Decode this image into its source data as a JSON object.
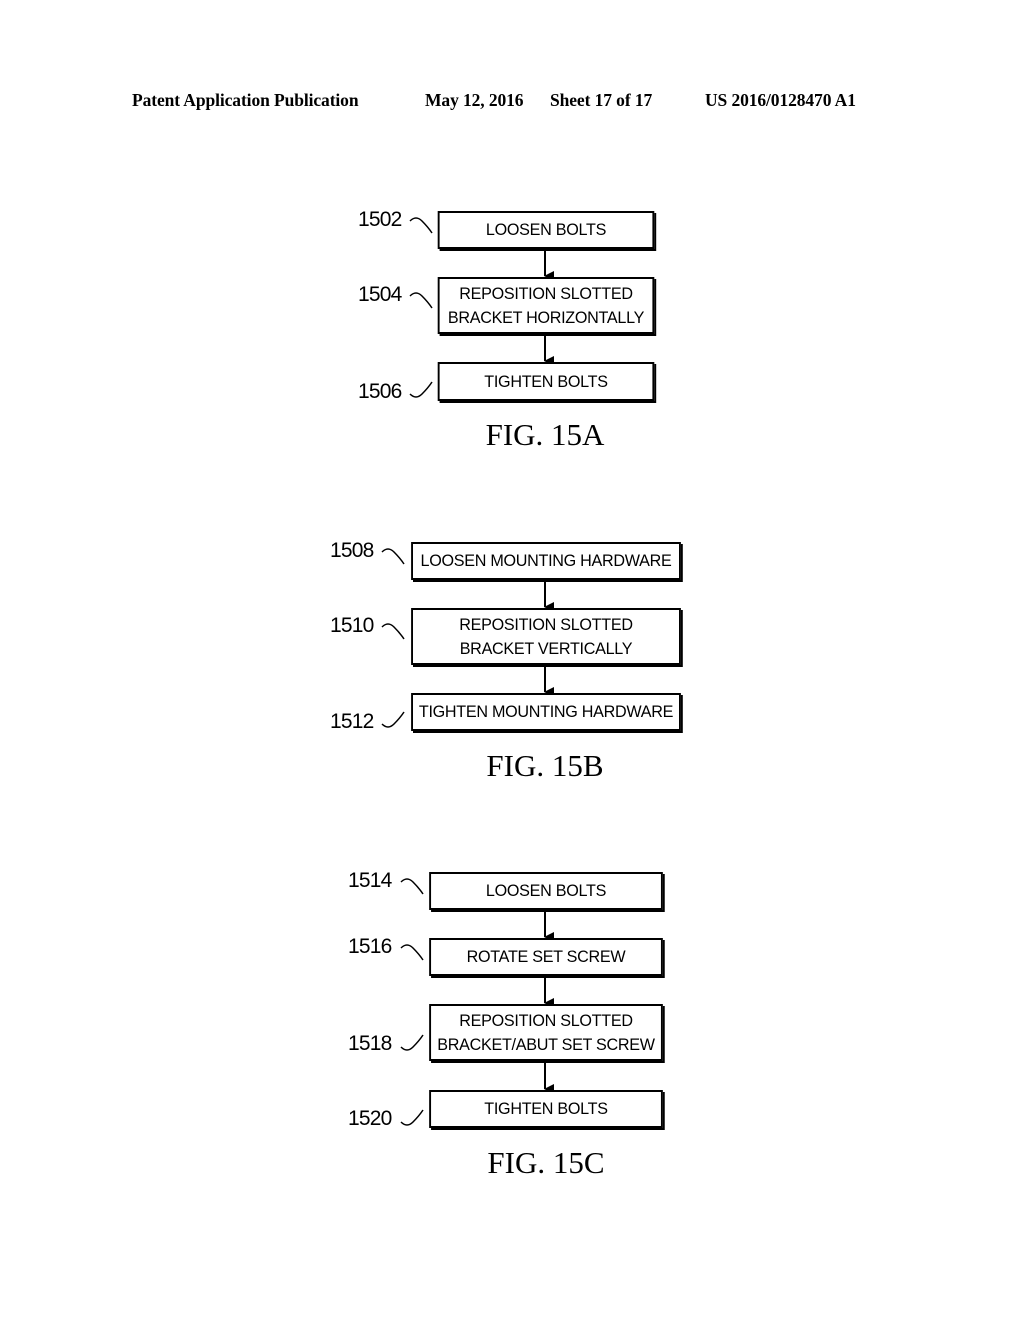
{
  "header": {
    "publication": "Patent Application Publication",
    "date": "May 12, 2016",
    "sheet": "Sheet 17 of 17",
    "number": "US 2016/0128470 A1"
  },
  "figures": [
    {
      "label": "FIG. 15A",
      "steps": [
        {
          "ref": "1502",
          "text": "LOOSEN BOLTS"
        },
        {
          "ref": "1504",
          "text": "REPOSITION SLOTTED\nBRACKET HORIZONTALLY"
        },
        {
          "ref": "1506",
          "text": "TIGHTEN BOLTS"
        }
      ]
    },
    {
      "label": "FIG. 15B",
      "steps": [
        {
          "ref": "1508",
          "text": "LOOSEN MOUNTING HARDWARE"
        },
        {
          "ref": "1510",
          "text": "REPOSITION SLOTTED\nBRACKET VERTICALLY"
        },
        {
          "ref": "1512",
          "text": "TIGHTEN MOUNTING HARDWARE"
        }
      ]
    },
    {
      "label": "FIG. 15C",
      "steps": [
        {
          "ref": "1514",
          "text": "LOOSEN BOLTS"
        },
        {
          "ref": "1516",
          "text": "ROTATE SET SCREW"
        },
        {
          "ref": "1518",
          "text": "REPOSITION SLOTTED\nBRACKET/ABUT SET SCREW"
        },
        {
          "ref": "1520",
          "text": "TIGHTEN BOLTS"
        }
      ]
    }
  ]
}
